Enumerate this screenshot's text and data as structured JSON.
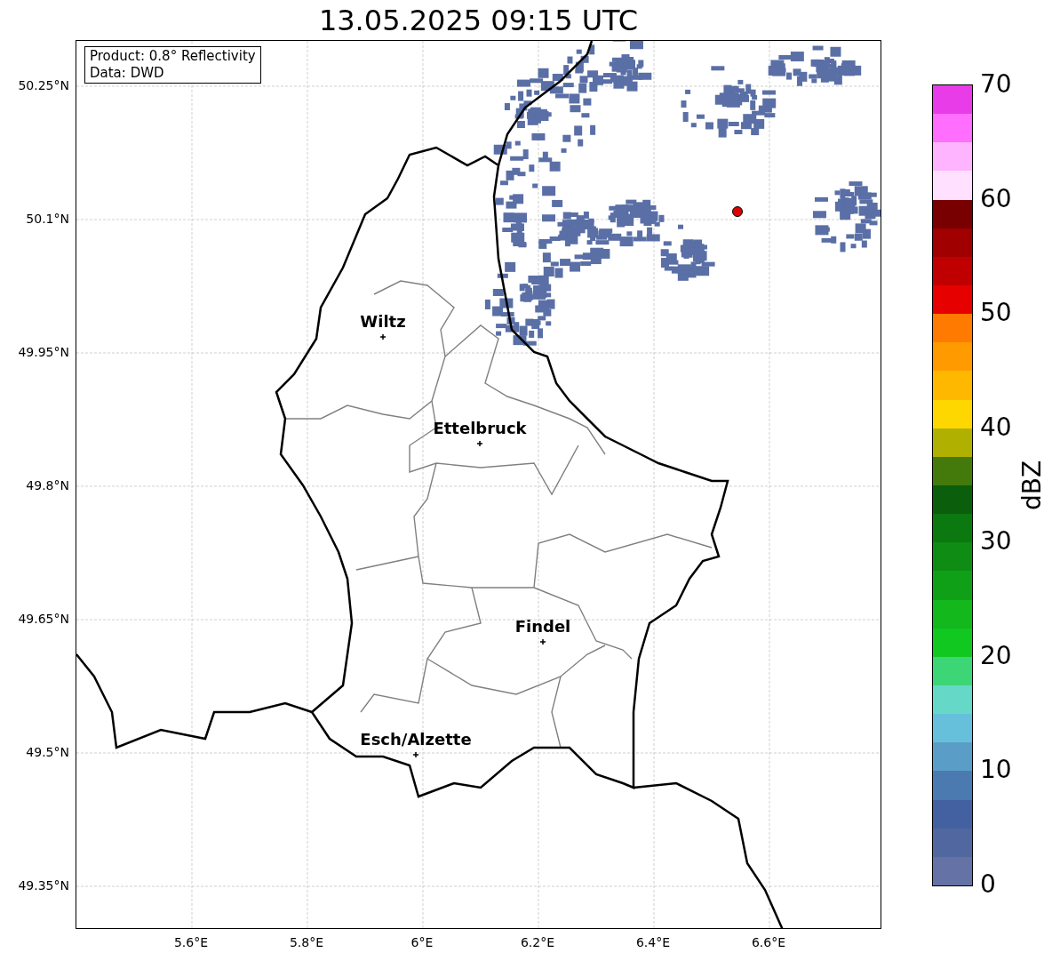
{
  "title": "13.05.2025 09:15 UTC",
  "info_box": [
    "Product: 0.8° Reflectivity",
    "Data: DWD"
  ],
  "y_ticks": [
    "50.25°N",
    "50.1°N",
    "49.95°N",
    "49.8°N",
    "49.65°N",
    "49.5°N",
    "49.35°N"
  ],
  "x_ticks": [
    "5.6°E",
    "5.8°E",
    "6°E",
    "6.2°E",
    "6.4°E",
    "6.6°E"
  ],
  "cities": [
    {
      "name": "Wiltz"
    },
    {
      "name": "Ettelbruck"
    },
    {
      "name": "Findel"
    },
    {
      "name": "Esch/Alzette"
    }
  ],
  "colorbar": {
    "label": "dBZ",
    "ticks": [
      "70",
      "60",
      "50",
      "40",
      "30",
      "20",
      "10",
      "0"
    ],
    "bins": [
      {
        "color": "#e93ce9"
      },
      {
        "color": "#ff6eff"
      },
      {
        "color": "#ffb4ff"
      },
      {
        "color": "#ffe0ff"
      },
      {
        "color": "#780000"
      },
      {
        "color": "#a00000"
      },
      {
        "color": "#c00000"
      },
      {
        "color": "#e60000"
      },
      {
        "color": "#ff7a00"
      },
      {
        "color": "#ff9a00"
      },
      {
        "color": "#ffb800"
      },
      {
        "color": "#ffd700"
      },
      {
        "color": "#b0b000"
      },
      {
        "color": "#447a0c"
      },
      {
        "color": "#0a5e0c"
      },
      {
        "color": "#0c7810"
      },
      {
        "color": "#0e8c14"
      },
      {
        "color": "#10a018"
      },
      {
        "color": "#12b81c"
      },
      {
        "color": "#10c820"
      },
      {
        "color": "#3dd677"
      },
      {
        "color": "#66d8c8"
      },
      {
        "color": "#66c0dc"
      },
      {
        "color": "#5a9ec8"
      },
      {
        "color": "#4a7ab0"
      },
      {
        "color": "#4360a0"
      },
      {
        "color": "#5067a0"
      },
      {
        "color": "#6572a6"
      }
    ]
  }
}
